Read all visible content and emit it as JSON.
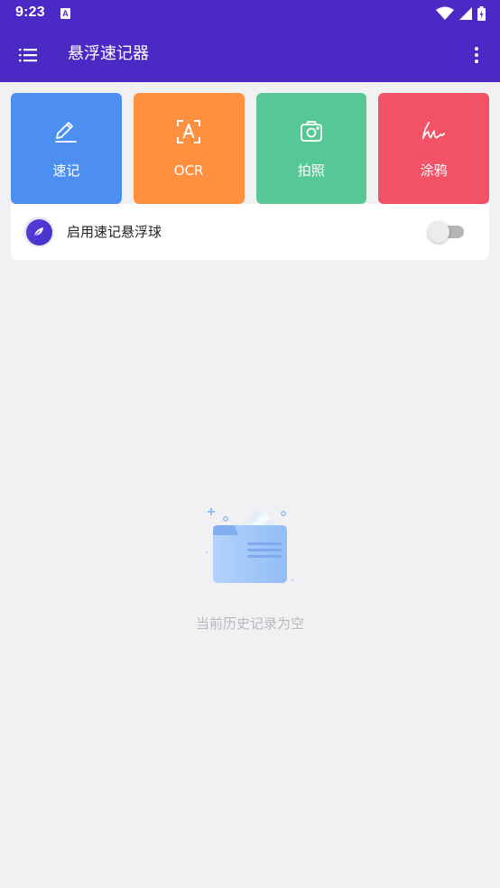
{
  "status_bar": {
    "time": "9:23",
    "notification_icon": "A",
    "icons": [
      "wifi-icon",
      "signal-icon",
      "battery-charging-icon"
    ]
  },
  "app_bar": {
    "title": "悬浮速记器",
    "menu_icon": "menu-icon",
    "more_icon": "more-vertical-icon"
  },
  "tiles": [
    {
      "label": "速记",
      "icon": "pencil-icon",
      "color": "#4d8ff0"
    },
    {
      "label": "OCR",
      "icon": "ocr-scan-icon",
      "color": "#ff9040"
    },
    {
      "label": "拍照",
      "icon": "camera-icon",
      "color": "#56c895"
    },
    {
      "label": "涂鸦",
      "icon": "scribble-icon",
      "color": "#f25265"
    }
  ],
  "floating_ball": {
    "label": "启用速记悬浮球",
    "icon": "feather-icon",
    "enabled": false
  },
  "empty_state": {
    "message": "当前历史记录为空",
    "icon": "empty-folder-icon"
  },
  "colors": {
    "primary": "#4b29c5",
    "background": "#f1f1f4"
  }
}
